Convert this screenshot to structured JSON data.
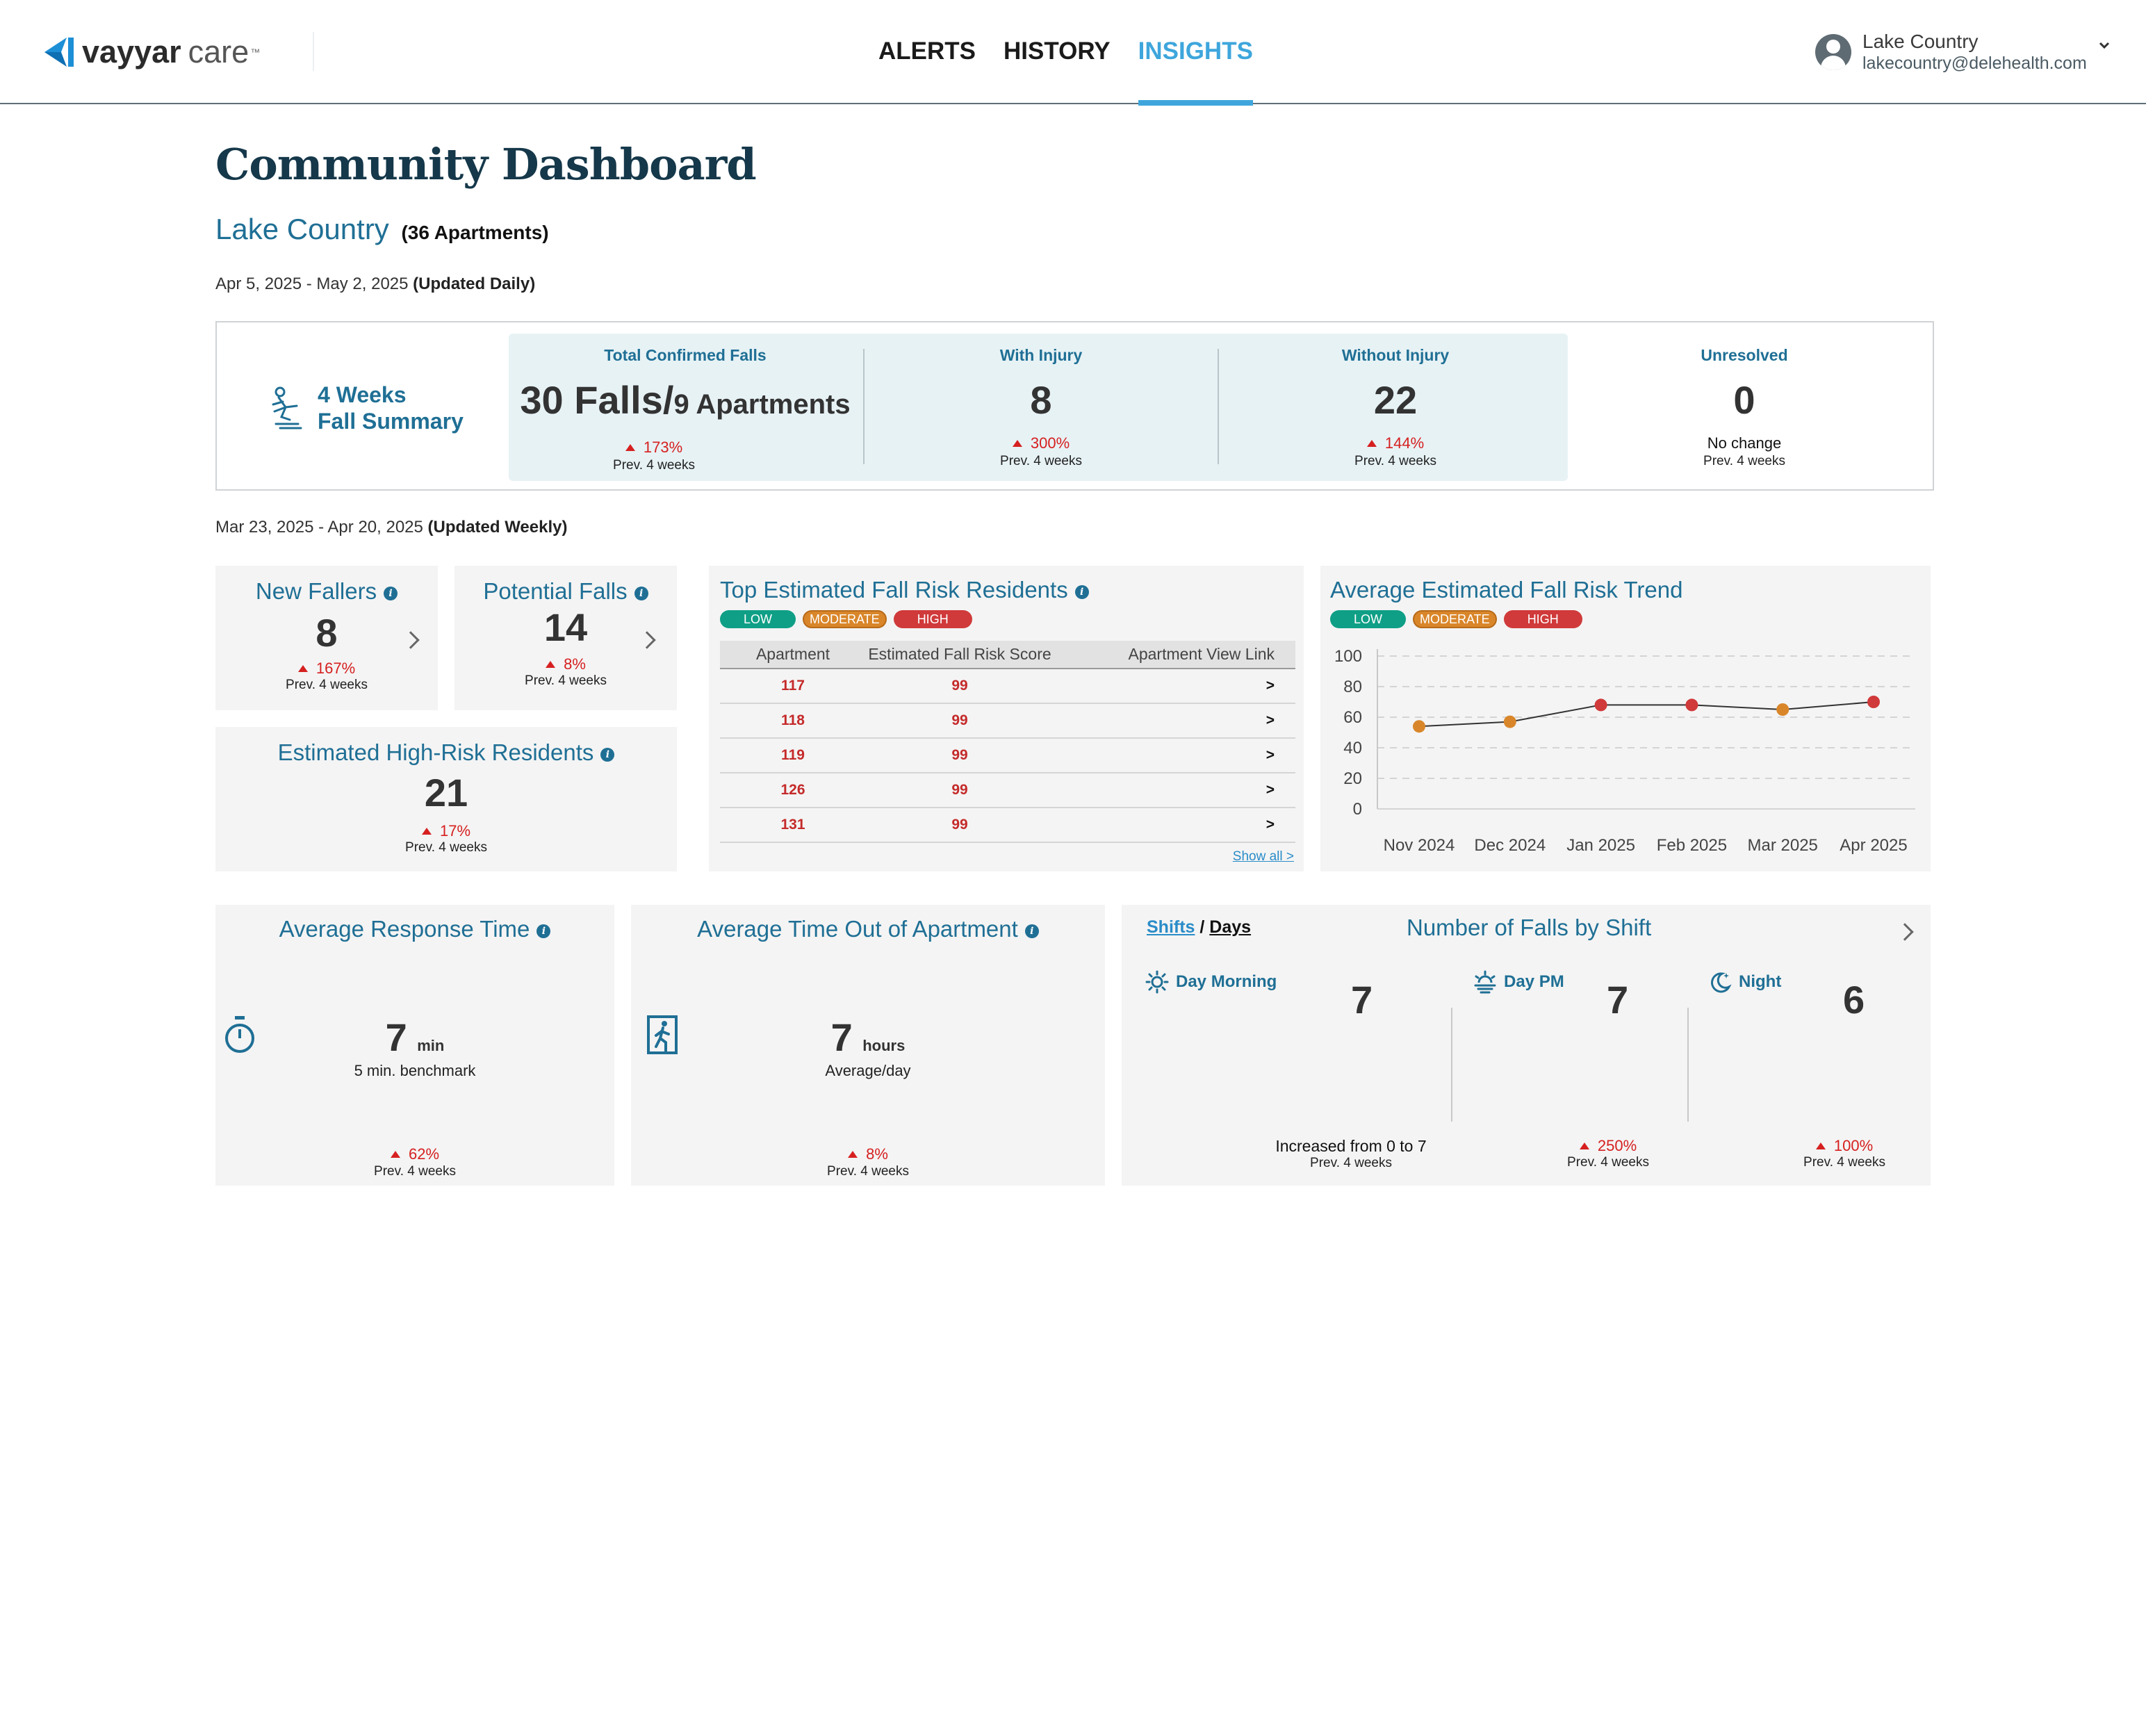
{
  "header": {
    "brand": "vayyar",
    "brand_suffix": "care",
    "brand_tm": "™",
    "nav": [
      "ALERTS",
      "HISTORY",
      "INSIGHTS"
    ],
    "active_nav": "INSIGHTS",
    "user_name": "Lake Country",
    "user_email": "lakecountry@delehealth.com"
  },
  "page": {
    "title": "Community Dashboard",
    "community": "Lake Country",
    "apartments": "(36 Apartments)",
    "daily_range": "Apr 5, 2025 - May 2, 2025",
    "daily_note": "(Updated Daily)",
    "weekly_range": "Mar 23, 2025 - Apr 20, 2025",
    "weekly_note": "(Updated Weekly)"
  },
  "fall_summary": {
    "label_line1": "4 Weeks",
    "label_line2": "Fall Summary",
    "total": {
      "heading": "Total Confirmed Falls",
      "falls": "30 Falls/",
      "apartments": "9 Apartments",
      "change": "173%",
      "prev": "Prev. 4 weeks"
    },
    "with_injury": {
      "heading": "With Injury",
      "value": "8",
      "change": "300%",
      "prev": "Prev. 4 weeks"
    },
    "without_injury": {
      "heading": "Without Injury",
      "value": "22",
      "change": "144%",
      "prev": "Prev. 4 weeks"
    },
    "unresolved": {
      "heading": "Unresolved",
      "value": "0",
      "change": "No change",
      "prev": "Prev. 4 weeks"
    }
  },
  "new_fallers": {
    "title": "New Fallers",
    "value": "8",
    "change": "167%",
    "prev": "Prev. 4 weeks"
  },
  "potential_falls": {
    "title": "Potential Falls",
    "value": "14",
    "change": "8%",
    "prev": "Prev. 4 weeks"
  },
  "high_risk": {
    "title": "Estimated High-Risk Residents",
    "value": "21",
    "change": "17%",
    "prev": "Prev. 4 weeks"
  },
  "risk_levels": {
    "low": "LOW",
    "moderate": "MODERATE",
    "high": "HIGH",
    "low_color": "#0f9f86",
    "moderate_color": "#d9862a",
    "high_color": "#d03a3a"
  },
  "top_risk": {
    "title": "Top Estimated Fall Risk Residents",
    "columns": [
      "Apartment",
      "Estimated Fall Risk Score",
      "Apartment View Link"
    ],
    "rows": [
      {
        "apartment": "117",
        "score": "99",
        "link": ">"
      },
      {
        "apartment": "118",
        "score": "99",
        "link": ">"
      },
      {
        "apartment": "119",
        "score": "99",
        "link": ">"
      },
      {
        "apartment": "126",
        "score": "99",
        "link": ">"
      },
      {
        "apartment": "131",
        "score": "99",
        "link": ">"
      }
    ],
    "show_all": "Show all >"
  },
  "trend": {
    "title": "Average Estimated Fall Risk Trend"
  },
  "chart_data": {
    "type": "line",
    "title": "Average Estimated Fall Risk Trend",
    "categories": [
      "Nov 2024",
      "Dec 2024",
      "Jan 2025",
      "Feb 2025",
      "Mar 2025",
      "Apr 2025"
    ],
    "series": [
      {
        "values": [
          54,
          57,
          68,
          68,
          65,
          70
        ]
      }
    ],
    "point_levels": [
      "moderate",
      "moderate",
      "high",
      "high",
      "moderate",
      "high"
    ],
    "ylim": [
      0,
      100
    ],
    "yticks": [
      0,
      20,
      40,
      60,
      80,
      100
    ],
    "grid": true
  },
  "response_time": {
    "title": "Average Response Time",
    "value": "7",
    "unit": "min",
    "sub": "5 min. benchmark",
    "change": "62%",
    "prev": "Prev. 4 weeks"
  },
  "time_out": {
    "title": "Average Time Out of Apartment",
    "value": "7",
    "unit": "hours",
    "sub": "Average/day",
    "change": "8%",
    "prev": "Prev. 4 weeks"
  },
  "shifts": {
    "toggle_shifts": "Shifts",
    "toggle_sep": " / ",
    "toggle_days": "Days",
    "title": "Number of Falls by Shift",
    "morning": {
      "label": "Day Morning",
      "value": "7",
      "change": "Increased from 0 to 7",
      "prev": "Prev. 4 weeks"
    },
    "pm": {
      "label": "Day PM",
      "value": "7",
      "change": "250%",
      "prev": "Prev. 4 weeks"
    },
    "night": {
      "label": "Night",
      "value": "6",
      "change": "100%",
      "prev": "Prev. 4 weeks"
    }
  }
}
